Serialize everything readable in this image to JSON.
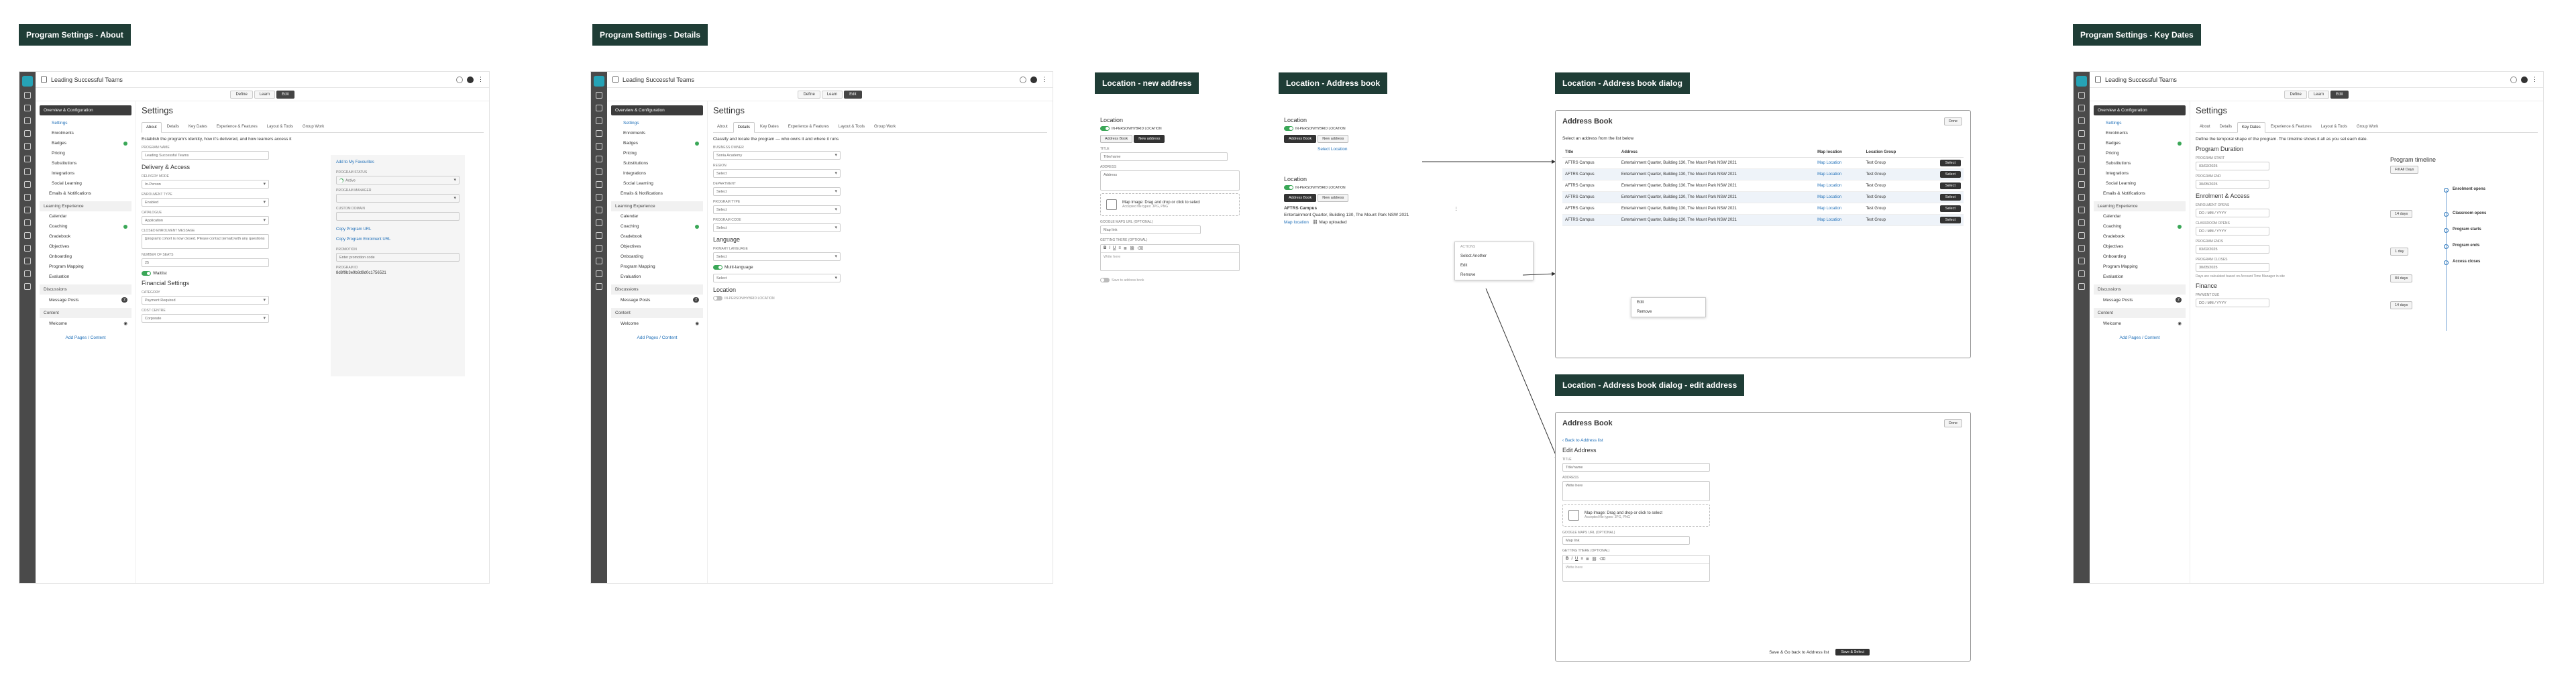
{
  "labels": {
    "about": "Program Settings - About",
    "details": "Program Settings - Details",
    "loc_new": "Location - new address",
    "loc_book": "Location - Address book",
    "loc_dialog": "Location - Address book dialog",
    "loc_edit": "Location - Address book dialog - edit address",
    "key_dates": "Program Settings - Key Dates"
  },
  "app": {
    "program_title": "Leading Successful Teams",
    "modes": [
      "Define",
      "Learn",
      "Edit"
    ],
    "settings_title": "Settings",
    "filter_label": "Settings",
    "filter_value": "Enable"
  },
  "nav": {
    "selected": "Overview & Configuration",
    "config_items": [
      "Settings",
      "Enrolments",
      "Badges",
      "Pricing",
      "Substitutions",
      "Integrations",
      "Social Learning",
      "Emails & Notifications"
    ],
    "learning_section": "Learning Experience",
    "learning_items": [
      "Calendar",
      "Coaching",
      "Gradebook",
      "Objectives",
      "Onboarding",
      "Program Mapping",
      "Evaluation"
    ],
    "discussions_section": "Discussions",
    "discussion_items": [
      "Message Posts"
    ],
    "content_section": "Content",
    "content_items": [
      "Welcome"
    ],
    "add": "Add Pages / Content"
  },
  "about": {
    "tabs": [
      "About",
      "Details",
      "Key Dates",
      "Experience & Features",
      "Layout & Tools",
      "Group Work"
    ],
    "intro": "Establish the program's identity, how it's delivered, and how learners access it",
    "program_name_label": "PROGRAM NAME",
    "program_name": "Leading Successful Teams",
    "delivery_heading": "Delivery & Access",
    "delivery_label": "DELIVERY MODE",
    "delivery_value": "In-Person",
    "enrolment_label": "ENROLMENT TYPE",
    "enrolment_value": "Enabled",
    "catalogue_label": "CATALOGUE",
    "catalogue_value": "Application",
    "access_label": "ACCESS",
    "access_value": "Always available",
    "closed_label": "CLOSED ENROLMENT MESSAGE",
    "closed_value": "[program] cohort is now closed. Please contact [email] with any questions",
    "seats_label": "NUMBER OF SEATS",
    "seats_value": "25",
    "waitlist": "Waitlist",
    "financial_heading": "Financial Settings",
    "category_label": "CATEGORY",
    "category_value": "Payment Required",
    "cost_label": "COST CENTRE",
    "cost_value": "Corporate",
    "side_add_trainer": "Add to My Favourites",
    "side_status_label": "PROGRAM STATUS",
    "side_status": "Active",
    "side_program_manager": "PROGRAM MANAGER",
    "side_type": "CUSTOM DOMAIN",
    "side_copy1": "Copy Program URL",
    "side_copy2": "Copy Program Enrolment URL",
    "side_promo": "PROMOTION",
    "side_promo_val": "Enter promotion code",
    "side_id_label": "PROGRAM ID",
    "side_id": "8d8f9b3e9b8d9d0c1756521"
  },
  "details": {
    "tabs": [
      "About",
      "Details",
      "Key Dates",
      "Experience & Features",
      "Layout & Tools",
      "Group Work"
    ],
    "intro": "Classify and locate the program — who owns it and where it runs",
    "owner_label": "BUSINESS OWNER",
    "owner_value": "Sonia Academy",
    "field2": "REGION",
    "field3": "DEPARTMENT",
    "field4": "PROGRAM TYPE",
    "field5": "PROGRAM CODE",
    "select": "Select",
    "language_heading": "Language",
    "language_label": "PRIMARY LANGUAGE",
    "multilang": "Multi-language",
    "location_heading": "Location",
    "location_toggle": "IN-PERSON/HYBRID LOCATION"
  },
  "loc_new": {
    "heading": "Location",
    "toggle": "IN-PERSON/HYBRID LOCATION",
    "btn_book": "Address Book",
    "btn_new": "New address",
    "title_label": "TITLE",
    "title_ph": "Title/name",
    "address_label": "ADDRESS",
    "address_ph": "Address",
    "img_text": "Map Image: Drag and drop or click to select",
    "img_sub": "Accepted file types: JPG, PNG",
    "map_label": "GOOGLE MAPS URL (OPTIONAL)",
    "map_ph": "Map link",
    "instr_label": "GETTING THERE (OPTIONAL)",
    "rte_ph": "Write here",
    "save": "Save to address book"
  },
  "loc_book": {
    "heading": "Location",
    "toggle": "IN-PERSON/HYBRID LOCATION",
    "btn_book": "Address Book",
    "btn_new": "New address",
    "select_link": "Select Location",
    "heading2": "Location",
    "card_title": "AFTRS Campus",
    "card_addr": "Entertainment Quarter, Building 130, The Mount Park NSW 2021",
    "card_map": "Map location",
    "card_instr": "Map uploaded",
    "menu": [
      "Select Another",
      "Edit",
      "Remove"
    ],
    "menu_head": "ACTIONS"
  },
  "dialog": {
    "title": "Address Book",
    "close": "Done",
    "intro": "Select an address from the list below",
    "cols": [
      "Title",
      "Address",
      "Map location",
      "Location Group",
      ""
    ],
    "rows": [
      [
        "AFTRS Campus",
        "Entertainment Quarter, Building 130, The Mount Park NSW 2021",
        "Map Location",
        "Test Group",
        "Select"
      ],
      [
        "AFTRS Campus",
        "Entertainment Quarter, Building 130, The Mount Park NSW 2021",
        "Map Location",
        "Test Group",
        "Select"
      ],
      [
        "AFTRS Campus",
        "Entertainment Quarter, Building 130, The Mount Park NSW 2021",
        "Map Location",
        "Test Group",
        "Select"
      ],
      [
        "AFTRS Campus",
        "Entertainment Quarter, Building 130, The Mount Park NSW 2021",
        "Map Location",
        "Test Group",
        "Select"
      ],
      [
        "AFTRS Campus",
        "Entertainment Quarter, Building 130, The Mount Park NSW 2021",
        "Map Location",
        "Test Group",
        "Select"
      ],
      [
        "AFTRS Campus",
        "Entertainment Quarter, Building 130, The Mount Park NSW 2021",
        "Map Location",
        "Test Group",
        "Select"
      ]
    ],
    "row_menu": [
      "Edit",
      "Remove"
    ]
  },
  "edit": {
    "title": "Address Book",
    "close": "Done",
    "back": "Back to Address list",
    "heading": "Edit Address",
    "title_label": "TITLE",
    "title_ph": "Title/name",
    "address_label": "ADDRESS",
    "address_ph": "Write here",
    "img_text": "Map Image: Drag and drop or click to select",
    "img_sub": "Accepted file types: JPG, PNG",
    "map_label": "GOOGLE MAPS URL (OPTIONAL)",
    "map_ph": "Map link",
    "instr_label": "GETTING THERE (OPTIONAL)",
    "rte_ph": "Write here",
    "save_back": "Save & Go back to Address list",
    "save_select": "Save & Select"
  },
  "key": {
    "tabs": [
      "About",
      "Details",
      "Key Dates",
      "Experience & Features",
      "Layout & Tools",
      "Group Work"
    ],
    "intro": "Define the temporal shape of the program. The timeline shows it all as you set each date.",
    "duration_heading": "Program Duration",
    "start_label": "PROGRAM START",
    "start_value": "03/02/2025",
    "end_label": "PROGRAM END",
    "end_value": "30/05/2025",
    "enrol_heading": "Enrolment & Access",
    "e1": "ENROLMENT OPENS",
    "e2": "CLASSROOM OPENS",
    "e3": "PROGRAM ENDS",
    "e4": "PROGRAM CLOSES",
    "date_ph": "DD / MM / YYYY",
    "d1": "03/02/2025",
    "d2": "30/05/2025",
    "finance_heading": "Finance",
    "f1": "PAYMENT DUE",
    "note": "Days are calculated based on Account Time Manager in site",
    "timeline_heading": "Program timeline",
    "timeline_btn": "Fill All Days",
    "tl_items": [
      "Enrolment opens",
      "Classroom opens",
      "Program starts",
      "Program ends",
      "Access closes"
    ],
    "tl_gaps": [
      "14 days",
      "1 day",
      "84 days",
      "14 days"
    ]
  }
}
